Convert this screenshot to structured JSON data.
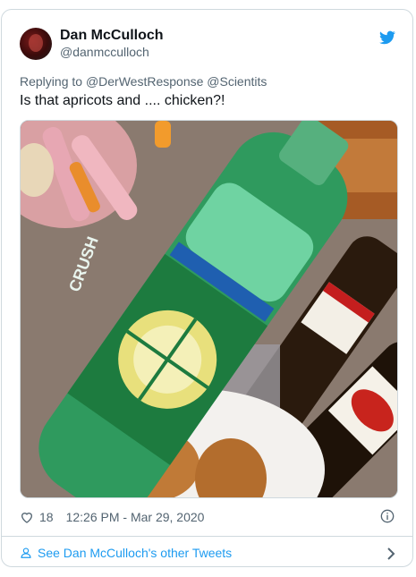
{
  "tweet": {
    "author_name": "Dan McCulloch",
    "author_handle": "@danmcculloch",
    "reply_prefix": "Replying to",
    "reply_to": "@DerWestResponse @Scientits",
    "text": "Is that apricots and .... chicken?!",
    "likes": "18",
    "timestamp": "12:26 PM - Mar 29, 2020"
  },
  "footer": {
    "see_more": "See Dan McCulloch's other Tweets"
  },
  "icons": {
    "brand": "twitter-bird-icon",
    "like": "heart-icon",
    "info": "info-icon",
    "profile": "person-icon",
    "more": "chevron-right-icon"
  },
  "colors": {
    "accent": "#1d9bf0",
    "text": "#0f1419",
    "muted": "#536471",
    "border": "#cfd9de"
  }
}
